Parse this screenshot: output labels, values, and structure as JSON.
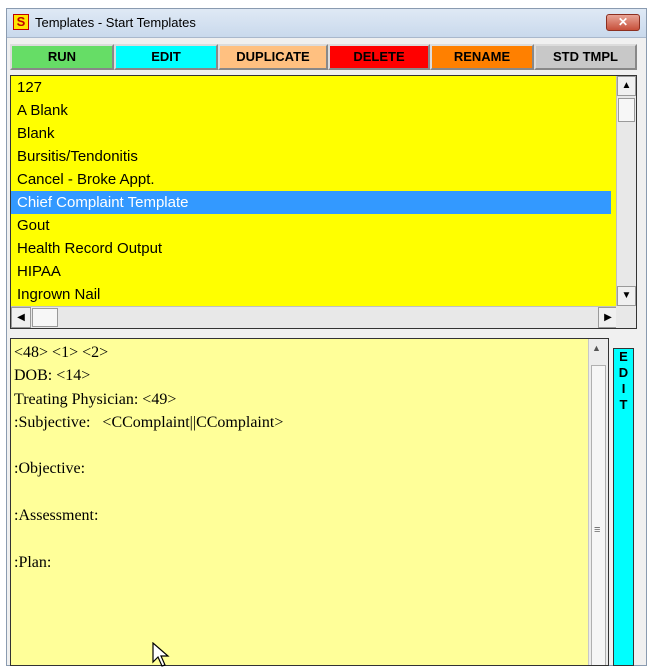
{
  "window": {
    "title": "Templates - Start Templates",
    "icon_letter": "S",
    "close_symbol": "✕"
  },
  "toolbar": {
    "buttons": [
      {
        "label": "RUN",
        "color": "#66dd66"
      },
      {
        "label": "EDIT",
        "color": "#00ffff"
      },
      {
        "label": "DUPLICATE",
        "color": "#ffc080"
      },
      {
        "label": "DELETE",
        "color": "#ff0000"
      },
      {
        "label": "RENAME",
        "color": "#ff8000"
      },
      {
        "label": "STD TMPL",
        "color": "#c8c8c8"
      }
    ]
  },
  "template_list": {
    "items": [
      "127",
      "A Blank",
      "Blank",
      "Bursitis/Tendonitis",
      "Cancel - Broke Appt.",
      "Chief Complaint Template",
      "Gout",
      "Health Record Output",
      "HIPAA",
      "Ingrown Nail"
    ],
    "selected": "Chief Complaint Template"
  },
  "editor": {
    "lines": [
      "<48> <1> <2>",
      "DOB: <14>",
      "Treating Physician: <49>",
      ":Subjective:   <CComplaint||CComplaint>",
      "",
      ":Objective:",
      "",
      ":Assessment:",
      "",
      ":Plan:"
    ]
  },
  "edit_strip": {
    "label": "EDIT"
  },
  "colors": {
    "list_bg": "#ffff00",
    "editor_bg": "#ffff99",
    "selection": "#3399ff",
    "edit_strip": "#00ffff"
  }
}
